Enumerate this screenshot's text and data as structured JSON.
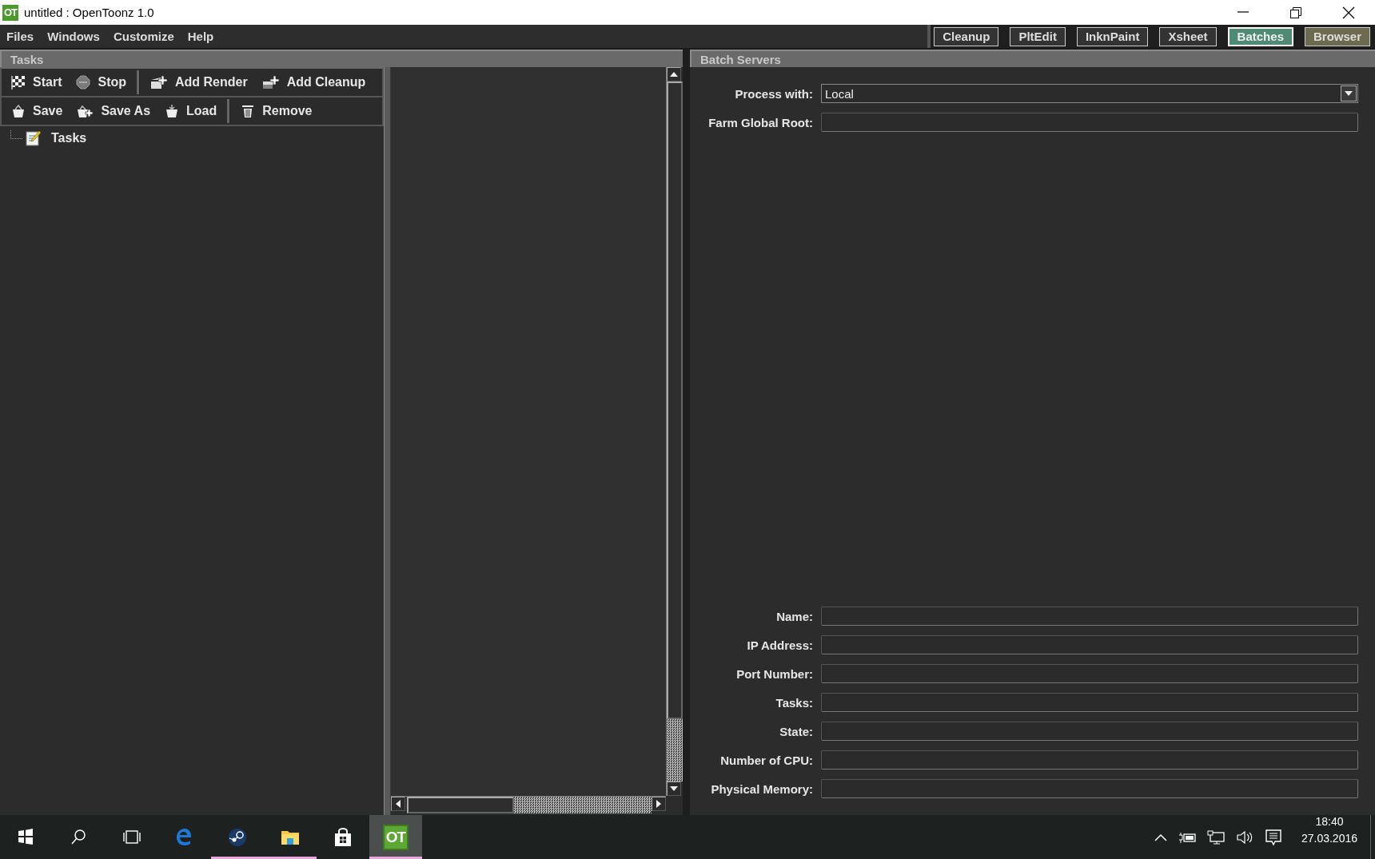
{
  "window": {
    "icon_label": "OT",
    "title": "untitled : OpenToonz 1.0"
  },
  "menu": [
    "Files",
    "Windows",
    "Customize",
    "Help"
  ],
  "rooms": [
    {
      "label": "Cleanup",
      "selected": false,
      "color": "#333333"
    },
    {
      "label": "PltEdit",
      "selected": false,
      "color": "#333333"
    },
    {
      "label": "InknPaint",
      "selected": false,
      "color": "#333333"
    },
    {
      "label": "Xsheet",
      "selected": false,
      "color": "#333333"
    },
    {
      "label": "Batches",
      "selected": true,
      "color": "#4f8a74"
    },
    {
      "label": "Browser",
      "selected": false,
      "color": "#6d6b4f"
    }
  ],
  "tasks_panel": {
    "title": "Tasks",
    "toolbar_rows": [
      [
        {
          "kind": "start",
          "label": "Start"
        },
        {
          "kind": "stop",
          "label": "Stop"
        },
        {
          "kind": "separator"
        },
        {
          "kind": "add-render",
          "label": "Add Render"
        },
        {
          "kind": "add-cleanup",
          "label": "Add Cleanup"
        }
      ],
      [
        {
          "kind": "save",
          "label": "Save"
        },
        {
          "kind": "save-as",
          "label": "Save As"
        },
        {
          "kind": "load",
          "label": "Load"
        },
        {
          "kind": "separator"
        },
        {
          "kind": "remove",
          "label": "Remove"
        }
      ]
    ],
    "tree": [
      {
        "label": "Tasks"
      }
    ]
  },
  "batch_servers": {
    "title": "Batch Servers",
    "process_with": {
      "label": "Process with:",
      "value": "Local"
    },
    "farm_global_root": {
      "label": "Farm Global Root:"
    },
    "server_fields": [
      {
        "label": "Name:"
      },
      {
        "label": "IP Address:"
      },
      {
        "label": "Port Number:"
      },
      {
        "label": "Tasks:"
      },
      {
        "label": "State:"
      },
      {
        "label": "Number of CPU:"
      },
      {
        "label": "Physical Memory:"
      }
    ]
  },
  "taskbar": {
    "system_buttons": [
      {
        "kind": "start"
      },
      {
        "kind": "search"
      },
      {
        "kind": "task-view"
      }
    ],
    "apps": [
      {
        "kind": "edge",
        "running": false,
        "selected": false
      },
      {
        "kind": "steam",
        "running": true,
        "selected": false
      },
      {
        "kind": "explorer",
        "running": true,
        "selected": false
      },
      {
        "kind": "store",
        "running": false,
        "selected": false
      },
      {
        "kind": "opentoonz",
        "label": "OT",
        "running": true,
        "selected": true
      }
    ],
    "tray": [
      {
        "kind": "chevron"
      },
      {
        "kind": "power"
      },
      {
        "kind": "network"
      },
      {
        "kind": "volume"
      },
      {
        "kind": "notifications"
      }
    ],
    "clock": {
      "time": "18:40",
      "date": "27.03.2016"
    }
  }
}
